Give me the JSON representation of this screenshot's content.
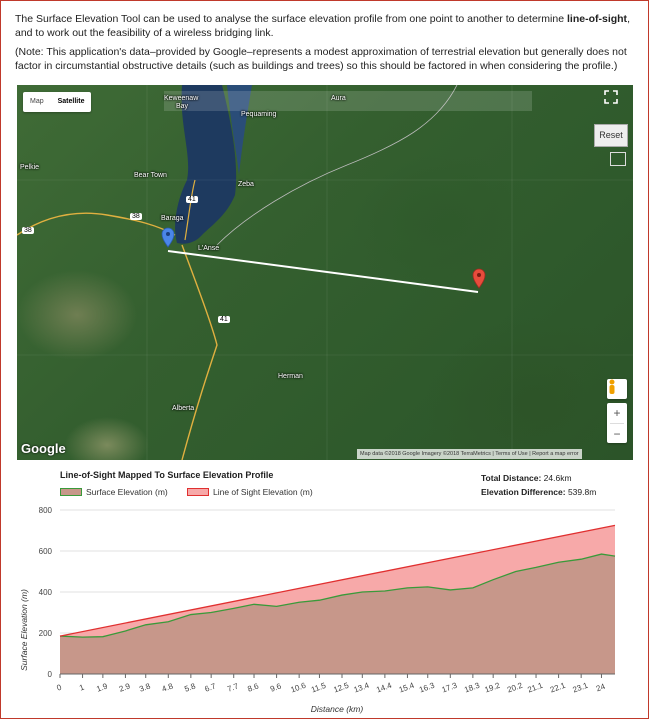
{
  "intro": {
    "p1_before": "The Surface Elevation Tool can be used to analyse the surface elevation profile from one point to another to determine ",
    "p1_bold": "line-of-sight",
    "p1_after": ", and to work out the feasibility of a wireless bridging link.",
    "p2": "(Note: This application's data–provided by Google–represents a modest approximation of terrestrial elevation but generally does not factor in circumstantial obstructive details (such as buildings and trees) so this should be factored in when considering the profile.)"
  },
  "map": {
    "type_map": "Map",
    "type_satellite": "Satellite",
    "reset_label": "Reset",
    "zoom_in": "+",
    "zoom_out": "−",
    "fullscreen_icon": "fullscreen-icon",
    "pegman_icon": "pegman-icon",
    "google_logo": "Google",
    "attribution": "Map data ©2018 Google Imagery ©2018 TerraMetrics | Terms of Use | Report a map error",
    "places": {
      "keweenaw": "Keweenaw",
      "bay": "Bay",
      "aura": "Aura",
      "pequaming": "Pequaming",
      "pelkie": "Pelkie",
      "bear_town": "Bear Town",
      "zeba": "Zeba",
      "baraga": "Baraga",
      "lanse": "L'Anse",
      "herman": "Herman",
      "alberta": "Alberta",
      "r41a": "41",
      "r41b": "41",
      "r38a": "38",
      "r38b": "38"
    },
    "colors": {
      "start_marker": "#4a86e8",
      "end_marker": "#e74c3c",
      "line": "#ffffff"
    }
  },
  "chart_data": {
    "type": "area",
    "title": "Line-of-Sight Mapped To Surface Elevation Profile",
    "xlabel": "Distance (km)",
    "ylabel": "Surface Elevation (m)",
    "xlim": [
      0,
      24.6
    ],
    "ylim": [
      0,
      800
    ],
    "yticks": [
      0,
      200,
      400,
      600,
      800
    ],
    "xticks": [
      "0",
      "1",
      "1.9",
      "2.9",
      "3.8",
      "4.8",
      "5.8",
      "6.7",
      "7.7",
      "8.6",
      "9.6",
      "10.6",
      "11.5",
      "12.5",
      "13.4",
      "14.4",
      "15.4",
      "16.3",
      "17.3",
      "18.3",
      "19.2",
      "20.2",
      "21.1",
      "22.1",
      "23.1",
      "24"
    ],
    "grid": "horizontal",
    "series": [
      {
        "name": "Surface Elevation (m)",
        "color": "#3a9a3a",
        "fill": "#c7978a",
        "x": [
          0,
          1,
          1.9,
          2.9,
          3.8,
          4.8,
          5.8,
          6.7,
          7.7,
          8.6,
          9.6,
          10.6,
          11.5,
          12.5,
          13.4,
          14.4,
          15.4,
          16.3,
          17.3,
          18.3,
          19.2,
          20.2,
          21.1,
          22.1,
          23.1,
          24,
          24.6
        ],
        "values": [
          185,
          180,
          182,
          210,
          240,
          255,
          290,
          300,
          320,
          340,
          330,
          350,
          360,
          385,
          400,
          405,
          420,
          425,
          410,
          420,
          460,
          500,
          520,
          545,
          560,
          585,
          575
        ]
      },
      {
        "name": "Line of Sight Elevation (m)",
        "color": "#e03030",
        "fill": "#f7a9a9",
        "x": [
          0,
          24.6
        ],
        "values": [
          185,
          725
        ]
      }
    ]
  },
  "stats": {
    "total_label": "Total Distance:",
    "total_value": "24.6km",
    "diff_label": "Elevation Difference:",
    "diff_value": "539.8m"
  }
}
